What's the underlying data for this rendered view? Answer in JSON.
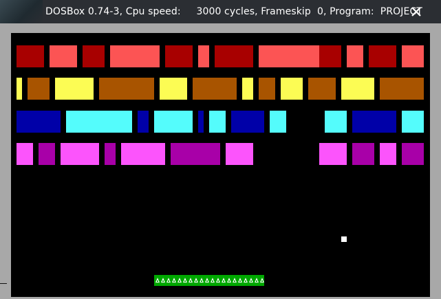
{
  "window": {
    "title": "DOSBox 0.74-3, Cpu speed:     3000 cycles, Frameskip  0, Program:  PROJECT"
  },
  "colors": {
    "window_bg": "#a8a8a8",
    "titlebar_bg": "#2b2e33",
    "screen_bg": "#000000",
    "red": "#a80000",
    "light_red": "#fc5454",
    "yellow": "#fcfc54",
    "brown": "#a85400",
    "blue": "#0000a8",
    "cyan": "#54fcfc",
    "magenta": "#a800a8",
    "light_magenta": "#fc54fc",
    "paddle": "#00a800",
    "ball": "#ffffff"
  },
  "icons": {
    "close": "close-icon",
    "paddle_pattern": "triangle-pattern"
  }
}
